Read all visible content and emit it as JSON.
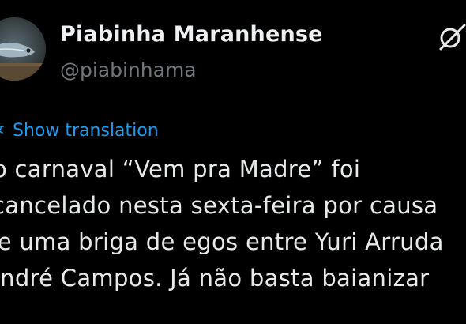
{
  "author": {
    "display_name": "Piabinha Maranhense",
    "handle": "@piabinhama"
  },
  "translation": {
    "label": "Show translation"
  },
  "tweet": {
    "lines": [
      "o carnaval “Vem pra Madre” foi",
      "cancelado nesta sexta-feira por causa",
      "de uma briga de egos entre Yuri Arruda",
      "André Campos. Já não basta baianizar"
    ]
  },
  "icons": {
    "grok": "grok-icon",
    "translate": "translate-icon"
  },
  "colors": {
    "background": "#000000",
    "name": "#eef0f2",
    "handle": "#71767b",
    "link": "#1d9bf0",
    "text": "#e7e9ea"
  }
}
